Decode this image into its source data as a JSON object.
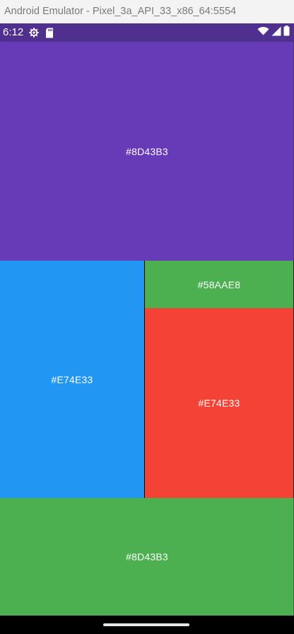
{
  "window": {
    "title": "Android Emulator - Pixel_3a_API_33_x86_64:5554"
  },
  "status_bar": {
    "time": "6:12",
    "icons_left": [
      "settings-gear-icon",
      "sd-card-icon"
    ],
    "icons_right": [
      "wifi-icon",
      "cell-signal-icon",
      "battery-icon"
    ],
    "background": "#50308F"
  },
  "tiles": {
    "top": {
      "label": "#8D43B3",
      "color": "#673AB7"
    },
    "left": {
      "label": "#E74E33",
      "color": "#2196F3"
    },
    "right_top": {
      "label": "#58AAE8",
      "color": "#4CAF50"
    },
    "right_bottom": {
      "label": "#E74E33",
      "color": "#F44336"
    },
    "bottom": {
      "label": "#8D43B3",
      "color": "#4CAF50"
    }
  },
  "nav_bar": {
    "handle": "home-gesture-handle"
  }
}
